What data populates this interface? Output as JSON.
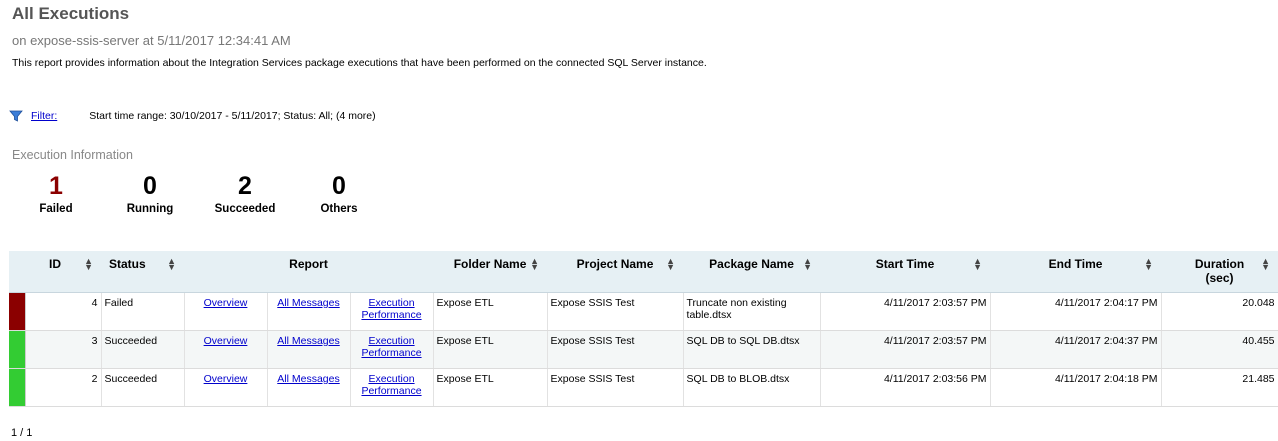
{
  "header": {
    "title": "All Executions",
    "subtitle": "on expose-ssis-server at 5/11/2017 12:34:41 AM",
    "description": "This report provides information about the Integration Services package executions that have been performed on the connected SQL Server instance."
  },
  "filter": {
    "label": "Filter:",
    "text": "Start time range: 30/10/2017 - 5/11/2017;  Status: All;  (4 more)"
  },
  "section_title": "Execution Information",
  "kpis": [
    {
      "value": "1",
      "label": "Failed",
      "color": "#8b0000"
    },
    {
      "value": "0",
      "label": "Running",
      "color": "#000000"
    },
    {
      "value": "2",
      "label": "Succeeded",
      "color": "#000000"
    },
    {
      "value": "0",
      "label": "Others",
      "color": "#000000"
    }
  ],
  "table": {
    "headers": {
      "id": "ID",
      "status": "Status",
      "report": "Report",
      "folder": "Folder Name",
      "project": "Project Name",
      "package": "Package Name",
      "start": "Start Time",
      "end": "End Time",
      "duration_1": "Duration",
      "duration_2": "(sec)"
    },
    "rows": [
      {
        "status_color": "#8b0000",
        "id": "4",
        "status": "Failed",
        "overview": "Overview",
        "all_messages": "All Messages",
        "exec_1": "Execution",
        "exec_2": "Performance",
        "folder": "Expose ETL",
        "project": "Expose SSIS Test",
        "package": "Truncate non existing table.dtsx",
        "start": "4/11/2017 2:03:57 PM",
        "end": "4/11/2017 2:04:17 PM",
        "duration": "20.048"
      },
      {
        "status_color": "#33cc33",
        "id": "3",
        "status": "Succeeded",
        "overview": "Overview",
        "all_messages": "All Messages",
        "exec_1": "Execution",
        "exec_2": "Performance",
        "folder": "Expose ETL",
        "project": "Expose SSIS Test",
        "package": "SQL DB to SQL DB.dtsx",
        "start": "4/11/2017 2:03:57 PM",
        "end": "4/11/2017 2:04:37 PM",
        "duration": "40.455"
      },
      {
        "status_color": "#33cc33",
        "id": "2",
        "status": "Succeeded",
        "overview": "Overview",
        "all_messages": "All Messages",
        "exec_1": "Execution",
        "exec_2": "Performance",
        "folder": "Expose ETL",
        "project": "Expose SSIS Test",
        "package": "SQL DB to BLOB.dtsx",
        "start": "4/11/2017 2:03:56 PM",
        "end": "4/11/2017 2:04:18 PM",
        "duration": "21.485"
      }
    ]
  },
  "pager": "1 / 1",
  "icons": {
    "filter": "funnel-icon",
    "sort": "sort-arrows-icon"
  }
}
